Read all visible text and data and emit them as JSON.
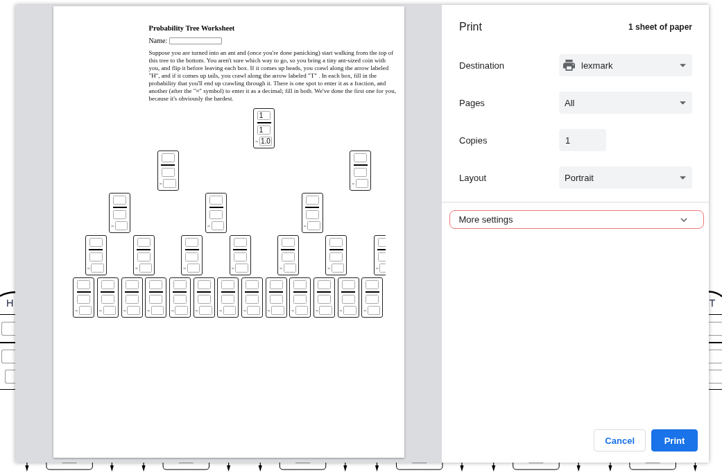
{
  "background_page": {
    "left_label": "H",
    "right_label": "T"
  },
  "preview": {
    "title": "Probability Tree Worksheet",
    "name_label": "Name:",
    "instructions": "Suppose you are turned into an ant and (once you're done panicking) start walking from the top of this tree to the bottom. You aren't sure which way to go, so you bring a tiny ant-sized coin with you, and flip it before leaving each box. If it comes up heads, you crawl along the arrow labeled \"H\", and if it comes up tails, you crawl along the arrow labeled \"T\" . In each box, fill in the probability that you'll end up crawling through it. There is one spot to enter it as a fraction, and another (after the \"≈\" symbol) to enter it as a decimal; fill in both. We've done the first one for you, because it's obviously the hardest.",
    "tree_rows": [
      {
        "nodes": [
          {
            "numerator": "1",
            "denominator": "1",
            "approx_sign": "≈",
            "decimal": "1.0"
          }
        ]
      },
      {
        "nodes": [
          {
            "approx_sign": "≈"
          },
          {
            "approx_sign": "≈"
          }
        ]
      },
      {
        "nodes": [
          {
            "approx_sign": "≈"
          },
          {
            "approx_sign": "≈"
          },
          {
            "approx_sign": "≈"
          }
        ]
      },
      {
        "nodes": [
          {
            "approx_sign": "≈"
          },
          {
            "approx_sign": "≈"
          },
          {
            "approx_sign": "≈"
          },
          {
            "approx_sign": "≈"
          },
          {
            "approx_sign": "≈"
          },
          {
            "approx_sign": "≈"
          },
          {
            "approx_sign": "≈"
          }
        ]
      },
      {
        "nodes": [
          {
            "approx_sign": "≈"
          },
          {
            "approx_sign": "≈"
          },
          {
            "approx_sign": "≈"
          },
          {
            "approx_sign": "≈"
          },
          {
            "approx_sign": "≈"
          },
          {
            "approx_sign": "≈"
          },
          {
            "approx_sign": "≈"
          },
          {
            "approx_sign": "≈"
          },
          {
            "approx_sign": "≈"
          },
          {
            "approx_sign": "≈"
          },
          {
            "approx_sign": "≈"
          },
          {
            "approx_sign": "≈"
          },
          {
            "approx_sign": "≈"
          }
        ]
      }
    ]
  },
  "settings": {
    "title": "Print",
    "summary": "1 sheet of paper",
    "fields": [
      {
        "label": "Destination",
        "kind": "destination",
        "value": "lexmark"
      },
      {
        "label": "Pages",
        "kind": "select",
        "value": "All"
      },
      {
        "label": "Copies",
        "kind": "number",
        "value": "1"
      },
      {
        "label": "Layout",
        "kind": "select",
        "value": "Portrait"
      }
    ],
    "more_settings": {
      "label": "More settings",
      "expanded": false,
      "highlighted": true
    },
    "buttons": [
      {
        "label": "Cancel",
        "kind": "secondary"
      },
      {
        "label": "Print",
        "kind": "primary"
      }
    ]
  }
}
